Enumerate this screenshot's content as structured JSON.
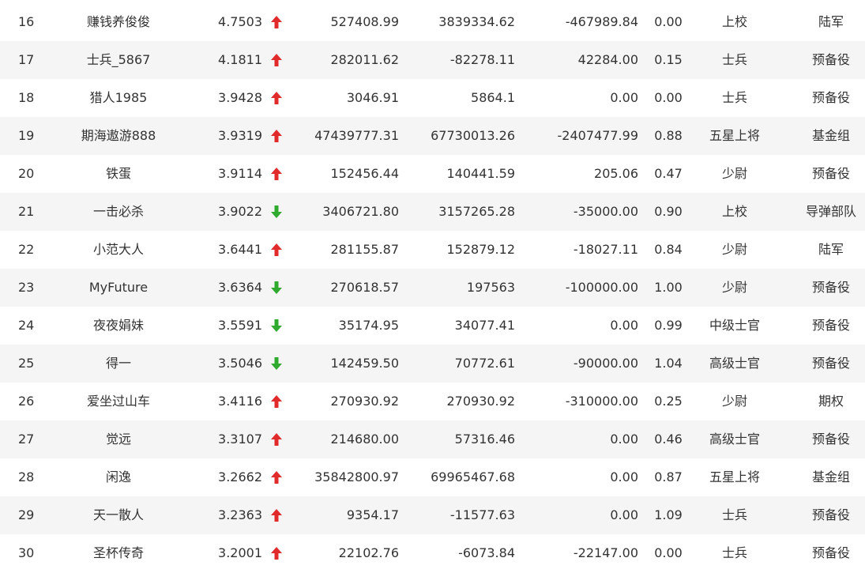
{
  "colors": {
    "up": "#e12b2b",
    "down": "#2eaa2e",
    "text": "#333333",
    "row_alt": "#f5f5f5"
  },
  "rows": [
    {
      "rank": "16",
      "name": "赚钱养俊俊",
      "score": "4.7503",
      "trend": "up",
      "v1": "527408.99",
      "v2": "3839334.62",
      "v3": "-467989.84",
      "ratio": "0.00",
      "rank_name": "上校",
      "group": "陆军"
    },
    {
      "rank": "17",
      "name": "士兵_5867",
      "score": "4.1811",
      "trend": "up",
      "v1": "282011.62",
      "v2": "-82278.11",
      "v3": "42284.00",
      "ratio": "0.15",
      "rank_name": "士兵",
      "group": "预备役"
    },
    {
      "rank": "18",
      "name": "猎人1985",
      "score": "3.9428",
      "trend": "up",
      "v1": "3046.91",
      "v2": "5864.1",
      "v3": "0.00",
      "ratio": "0.00",
      "rank_name": "士兵",
      "group": "预备役"
    },
    {
      "rank": "19",
      "name": "期海遨游888",
      "score": "3.9319",
      "trend": "up",
      "v1": "47439777.31",
      "v2": "67730013.26",
      "v3": "-2407477.99",
      "ratio": "0.88",
      "rank_name": "五星上将",
      "group": "基金组"
    },
    {
      "rank": "20",
      "name": "铁蛋",
      "score": "3.9114",
      "trend": "up",
      "v1": "152456.44",
      "v2": "140441.59",
      "v3": "205.06",
      "ratio": "0.47",
      "rank_name": "少尉",
      "group": "预备役"
    },
    {
      "rank": "21",
      "name": "一击必杀",
      "score": "3.9022",
      "trend": "down",
      "v1": "3406721.80",
      "v2": "3157265.28",
      "v3": "-35000.00",
      "ratio": "0.90",
      "rank_name": "上校",
      "group": "导弹部队"
    },
    {
      "rank": "22",
      "name": "小范大人",
      "score": "3.6441",
      "trend": "up",
      "v1": "281155.87",
      "v2": "152879.12",
      "v3": "-18027.11",
      "ratio": "0.84",
      "rank_name": "少尉",
      "group": "陆军"
    },
    {
      "rank": "23",
      "name": "MyFuture",
      "score": "3.6364",
      "trend": "down",
      "v1": "270618.57",
      "v2": "197563",
      "v3": "-100000.00",
      "ratio": "1.00",
      "rank_name": "少尉",
      "group": "预备役"
    },
    {
      "rank": "24",
      "name": "夜夜娟妹",
      "score": "3.5591",
      "trend": "down",
      "v1": "35174.95",
      "v2": "34077.41",
      "v3": "0.00",
      "ratio": "0.99",
      "rank_name": "中级士官",
      "group": "预备役"
    },
    {
      "rank": "25",
      "name": "得一",
      "score": "3.5046",
      "trend": "down",
      "v1": "142459.50",
      "v2": "70772.61",
      "v3": "-90000.00",
      "ratio": "1.04",
      "rank_name": "高级士官",
      "group": "预备役"
    },
    {
      "rank": "26",
      "name": "爱坐过山车",
      "score": "3.4116",
      "trend": "up",
      "v1": "270930.92",
      "v2": "270930.92",
      "v3": "-310000.00",
      "ratio": "0.25",
      "rank_name": "少尉",
      "group": "期权"
    },
    {
      "rank": "27",
      "name": "觉远",
      "score": "3.3107",
      "trend": "up",
      "v1": "214680.00",
      "v2": "57316.46",
      "v3": "0.00",
      "ratio": "0.46",
      "rank_name": "高级士官",
      "group": "预备役"
    },
    {
      "rank": "28",
      "name": "闲逸",
      "score": "3.2662",
      "trend": "up",
      "v1": "35842800.97",
      "v2": "69965467.68",
      "v3": "0.00",
      "ratio": "0.87",
      "rank_name": "五星上将",
      "group": "基金组"
    },
    {
      "rank": "29",
      "name": "天一散人",
      "score": "3.2363",
      "trend": "up",
      "v1": "9354.17",
      "v2": "-11577.63",
      "v3": "0.00",
      "ratio": "1.09",
      "rank_name": "士兵",
      "group": "预备役"
    },
    {
      "rank": "30",
      "name": "圣杯传奇",
      "score": "3.2001",
      "trend": "up",
      "v1": "22102.76",
      "v2": "-6073.84",
      "v3": "-22147.00",
      "ratio": "0.00",
      "rank_name": "士兵",
      "group": "预备役"
    }
  ]
}
